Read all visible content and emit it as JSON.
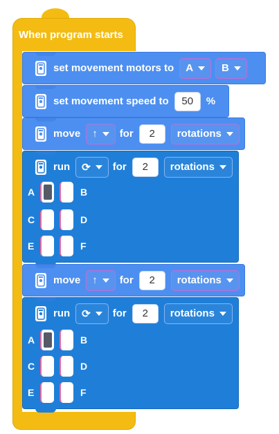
{
  "event": {
    "label": "When program starts"
  },
  "colors": {
    "event": "#f4bc12",
    "block": "#4d8ff0",
    "block_dark": "#1f7fd8",
    "port_active": "#555a66"
  },
  "blocks": {
    "motors": {
      "label": "set movement motors to",
      "left": "A",
      "right": "B"
    },
    "speed": {
      "label": "set movement speed to",
      "value": "50",
      "unit": "%"
    },
    "move1": {
      "label": "move",
      "direction_icon": "arrow-up-icon",
      "direction": "↑",
      "for": "for",
      "value": "2",
      "unit": "rotations"
    },
    "run1": {
      "label": "run",
      "mode_icon": "clockwise-icon",
      "mode": "⟳",
      "for": "for",
      "value": "2",
      "unit": "rotations",
      "ports": [
        {
          "left": "A",
          "right": "B",
          "left_active": true,
          "right_active": false
        },
        {
          "left": "C",
          "right": "D",
          "left_active": false,
          "right_active": false
        },
        {
          "left": "E",
          "right": "F",
          "left_active": false,
          "right_active": false
        }
      ]
    },
    "move2": {
      "label": "move",
      "direction_icon": "arrow-up-icon",
      "direction": "↑",
      "for": "for",
      "value": "2",
      "unit": "rotations"
    },
    "run2": {
      "label": "run",
      "mode_icon": "clockwise-icon",
      "mode": "⟳",
      "for": "for",
      "value": "2",
      "unit": "rotations",
      "ports": [
        {
          "left": "A",
          "right": "B",
          "left_active": true,
          "right_active": false
        },
        {
          "left": "C",
          "right": "D",
          "left_active": false,
          "right_active": false
        },
        {
          "left": "E",
          "right": "F",
          "left_active": false,
          "right_active": false
        }
      ]
    }
  }
}
